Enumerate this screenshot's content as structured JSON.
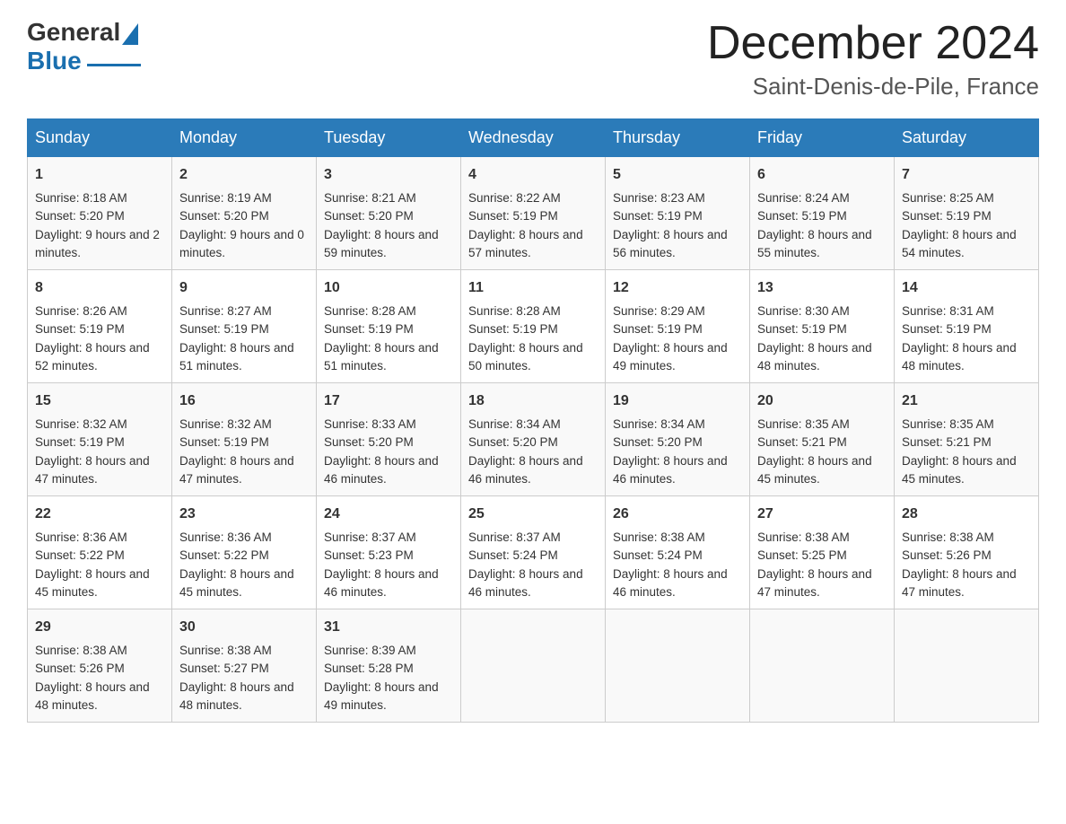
{
  "logo": {
    "general": "General",
    "blue": "Blue"
  },
  "title": "December 2024",
  "location": "Saint-Denis-de-Pile, France",
  "days_of_week": [
    "Sunday",
    "Monday",
    "Tuesday",
    "Wednesday",
    "Thursday",
    "Friday",
    "Saturday"
  ],
  "weeks": [
    [
      {
        "day": "1",
        "sunrise": "8:18 AM",
        "sunset": "5:20 PM",
        "daylight": "9 hours and 2 minutes."
      },
      {
        "day": "2",
        "sunrise": "8:19 AM",
        "sunset": "5:20 PM",
        "daylight": "9 hours and 0 minutes."
      },
      {
        "day": "3",
        "sunrise": "8:21 AM",
        "sunset": "5:20 PM",
        "daylight": "8 hours and 59 minutes."
      },
      {
        "day": "4",
        "sunrise": "8:22 AM",
        "sunset": "5:19 PM",
        "daylight": "8 hours and 57 minutes."
      },
      {
        "day": "5",
        "sunrise": "8:23 AM",
        "sunset": "5:19 PM",
        "daylight": "8 hours and 56 minutes."
      },
      {
        "day": "6",
        "sunrise": "8:24 AM",
        "sunset": "5:19 PM",
        "daylight": "8 hours and 55 minutes."
      },
      {
        "day": "7",
        "sunrise": "8:25 AM",
        "sunset": "5:19 PM",
        "daylight": "8 hours and 54 minutes."
      }
    ],
    [
      {
        "day": "8",
        "sunrise": "8:26 AM",
        "sunset": "5:19 PM",
        "daylight": "8 hours and 52 minutes."
      },
      {
        "day": "9",
        "sunrise": "8:27 AM",
        "sunset": "5:19 PM",
        "daylight": "8 hours and 51 minutes."
      },
      {
        "day": "10",
        "sunrise": "8:28 AM",
        "sunset": "5:19 PM",
        "daylight": "8 hours and 51 minutes."
      },
      {
        "day": "11",
        "sunrise": "8:28 AM",
        "sunset": "5:19 PM",
        "daylight": "8 hours and 50 minutes."
      },
      {
        "day": "12",
        "sunrise": "8:29 AM",
        "sunset": "5:19 PM",
        "daylight": "8 hours and 49 minutes."
      },
      {
        "day": "13",
        "sunrise": "8:30 AM",
        "sunset": "5:19 PM",
        "daylight": "8 hours and 48 minutes."
      },
      {
        "day": "14",
        "sunrise": "8:31 AM",
        "sunset": "5:19 PM",
        "daylight": "8 hours and 48 minutes."
      }
    ],
    [
      {
        "day": "15",
        "sunrise": "8:32 AM",
        "sunset": "5:19 PM",
        "daylight": "8 hours and 47 minutes."
      },
      {
        "day": "16",
        "sunrise": "8:32 AM",
        "sunset": "5:19 PM",
        "daylight": "8 hours and 47 minutes."
      },
      {
        "day": "17",
        "sunrise": "8:33 AM",
        "sunset": "5:20 PM",
        "daylight": "8 hours and 46 minutes."
      },
      {
        "day": "18",
        "sunrise": "8:34 AM",
        "sunset": "5:20 PM",
        "daylight": "8 hours and 46 minutes."
      },
      {
        "day": "19",
        "sunrise": "8:34 AM",
        "sunset": "5:20 PM",
        "daylight": "8 hours and 46 minutes."
      },
      {
        "day": "20",
        "sunrise": "8:35 AM",
        "sunset": "5:21 PM",
        "daylight": "8 hours and 45 minutes."
      },
      {
        "day": "21",
        "sunrise": "8:35 AM",
        "sunset": "5:21 PM",
        "daylight": "8 hours and 45 minutes."
      }
    ],
    [
      {
        "day": "22",
        "sunrise": "8:36 AM",
        "sunset": "5:22 PM",
        "daylight": "8 hours and 45 minutes."
      },
      {
        "day": "23",
        "sunrise": "8:36 AM",
        "sunset": "5:22 PM",
        "daylight": "8 hours and 45 minutes."
      },
      {
        "day": "24",
        "sunrise": "8:37 AM",
        "sunset": "5:23 PM",
        "daylight": "8 hours and 46 minutes."
      },
      {
        "day": "25",
        "sunrise": "8:37 AM",
        "sunset": "5:24 PM",
        "daylight": "8 hours and 46 minutes."
      },
      {
        "day": "26",
        "sunrise": "8:38 AM",
        "sunset": "5:24 PM",
        "daylight": "8 hours and 46 minutes."
      },
      {
        "day": "27",
        "sunrise": "8:38 AM",
        "sunset": "5:25 PM",
        "daylight": "8 hours and 47 minutes."
      },
      {
        "day": "28",
        "sunrise": "8:38 AM",
        "sunset": "5:26 PM",
        "daylight": "8 hours and 47 minutes."
      }
    ],
    [
      {
        "day": "29",
        "sunrise": "8:38 AM",
        "sunset": "5:26 PM",
        "daylight": "8 hours and 48 minutes."
      },
      {
        "day": "30",
        "sunrise": "8:38 AM",
        "sunset": "5:27 PM",
        "daylight": "8 hours and 48 minutes."
      },
      {
        "day": "31",
        "sunrise": "8:39 AM",
        "sunset": "5:28 PM",
        "daylight": "8 hours and 49 minutes."
      },
      {
        "day": "",
        "sunrise": "",
        "sunset": "",
        "daylight": ""
      },
      {
        "day": "",
        "sunrise": "",
        "sunset": "",
        "daylight": ""
      },
      {
        "day": "",
        "sunrise": "",
        "sunset": "",
        "daylight": ""
      },
      {
        "day": "",
        "sunrise": "",
        "sunset": "",
        "daylight": ""
      }
    ]
  ],
  "labels": {
    "sunrise_prefix": "Sunrise: ",
    "sunset_prefix": "Sunset: ",
    "daylight_prefix": "Daylight: "
  }
}
